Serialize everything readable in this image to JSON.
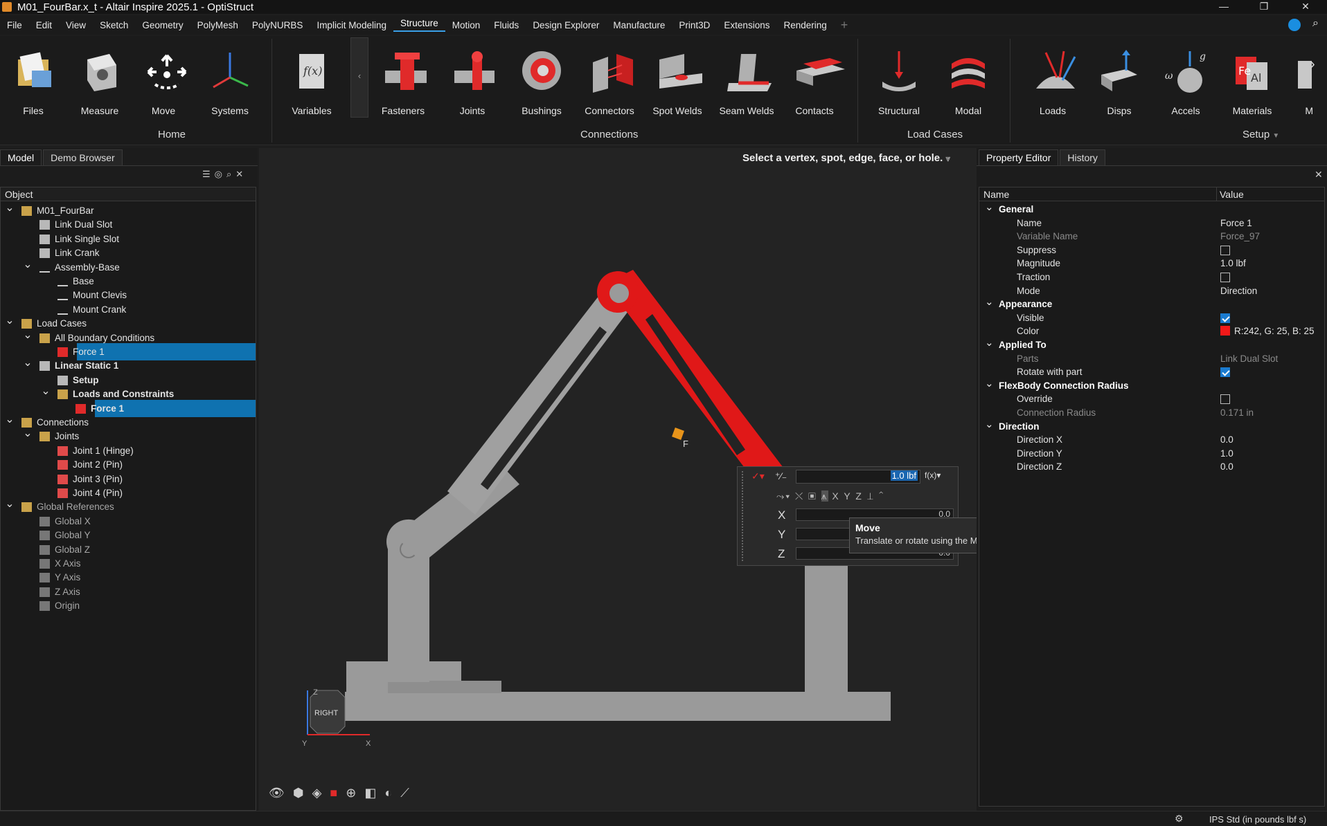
{
  "window": {
    "title": "M01_FourBar.x_t - Altair Inspire 2025.1 - OptiStruct"
  },
  "menu": [
    "File",
    "Edit",
    "View",
    "Sketch",
    "Geometry",
    "PolyMesh",
    "PolyNURBS",
    "Implicit Modeling",
    "Structure",
    "Motion",
    "Fluids",
    "Design Explorer",
    "Manufacture",
    "Print3D",
    "Extensions",
    "Rendering"
  ],
  "ribbon": {
    "home": {
      "group": "Home",
      "tools": [
        "Files",
        "Measure",
        "Move",
        "Systems"
      ]
    },
    "variables": "Variables",
    "connections": {
      "group": "Connections",
      "tools": [
        "Fasteners",
        "Joints",
        "Bushings",
        "Connectors",
        "Spot Welds",
        "Seam Welds",
        "Contacts"
      ]
    },
    "loadcases": {
      "group": "Load Cases",
      "tools": [
        "Structural",
        "Modal"
      ]
    },
    "setup": {
      "group": "Setup",
      "tools": [
        "Loads",
        "Disps",
        "Accels",
        "Materials",
        "M"
      ]
    }
  },
  "left": {
    "tabs": [
      "Model",
      "Demo Browser"
    ],
    "column": "Object",
    "rows": [
      {
        "label": "M01_FourBar",
        "level": 0,
        "chev": "v"
      },
      {
        "label": "Link Dual Slot",
        "level": 1
      },
      {
        "label": "Link Single Slot",
        "level": 1
      },
      {
        "label": "Link Crank",
        "level": 1
      },
      {
        "label": "Assembly-Base",
        "level": 1,
        "chev": "v"
      },
      {
        "label": "Base",
        "level": 2
      },
      {
        "label": "Mount Clevis",
        "level": 2
      },
      {
        "label": "Mount Crank",
        "level": 2
      },
      {
        "label": "Load Cases",
        "level": 0,
        "chev": "v"
      },
      {
        "label": "All Boundary Conditions",
        "level": 1,
        "chev": "v"
      },
      {
        "label": "Force 1",
        "level": 2,
        "sel": true
      },
      {
        "label": "Linear Static 1",
        "level": 1,
        "chev": "v",
        "bold": true
      },
      {
        "label": "Setup",
        "level": 2,
        "bold": true
      },
      {
        "label": "Loads and Constraints",
        "level": 2,
        "chev": "v",
        "bold": true
      },
      {
        "label": "Force 1",
        "level": 3,
        "sel": true,
        "bold": true
      },
      {
        "label": "Connections",
        "level": 0,
        "chev": "v"
      },
      {
        "label": "Joints",
        "level": 1,
        "chev": "v"
      },
      {
        "label": "Joint 1 (Hinge)",
        "level": 2
      },
      {
        "label": "Joint 2 (Pin)",
        "level": 2
      },
      {
        "label": "Joint 3 (Pin)",
        "level": 2
      },
      {
        "label": "Joint 4 (Pin)",
        "level": 2
      },
      {
        "label": "Global References",
        "level": 0,
        "chev": "v",
        "dim": true
      },
      {
        "label": "Global X",
        "level": 1,
        "dim": true
      },
      {
        "label": "Global Y",
        "level": 1,
        "dim": true
      },
      {
        "label": "Global Z",
        "level": 1,
        "dim": true
      },
      {
        "label": "X Axis",
        "level": 1,
        "dim": true
      },
      {
        "label": "Y Axis",
        "level": 1,
        "dim": true
      },
      {
        "label": "Z Axis",
        "level": 1,
        "dim": true
      },
      {
        "label": "Origin",
        "level": 1,
        "dim": true
      }
    ]
  },
  "viewport": {
    "prompt": "Select a vertex, spot, edge, face, or hole.",
    "force_label": "F",
    "microdialog": {
      "magnitude": "1.0 lbf",
      "fx": "f(x)",
      "x": "X",
      "y": "Y",
      "z": "Z",
      "xval": "0.0",
      "zval": "0.0",
      "axes": [
        "X",
        "Y",
        "Z"
      ]
    },
    "tooltip": {
      "title": "Move",
      "text": "Translate or rotate using the Move tool."
    },
    "viewcube": "RIGHT",
    "triad": {
      "z": "Z",
      "y": "Y",
      "x": "X"
    }
  },
  "right": {
    "tabs": [
      "Property Editor",
      "History"
    ],
    "col_name": "Name",
    "col_value": "Value",
    "rows": [
      {
        "t": "cat",
        "name": "General"
      },
      {
        "name": "Name",
        "value": "Force 1"
      },
      {
        "name": "Variable Name",
        "value": "Force_97",
        "dim": true
      },
      {
        "name": "Suppress",
        "cb": false
      },
      {
        "name": "Magnitude",
        "value": "1.0 lbf"
      },
      {
        "name": "Traction",
        "cb": false
      },
      {
        "name": "Mode",
        "value": "Direction"
      },
      {
        "t": "cat",
        "name": "Appearance"
      },
      {
        "name": "Visible",
        "cb": true
      },
      {
        "name": "Color",
        "value": "R:242, G: 25, B: 25",
        "swatch": "#f21919"
      },
      {
        "t": "cat",
        "name": "Applied To"
      },
      {
        "name": "Parts",
        "value": "Link Dual Slot",
        "dim": true
      },
      {
        "name": "Rotate with part",
        "cb": true
      },
      {
        "t": "cat",
        "name": "FlexBody Connection Radius"
      },
      {
        "name": "Override",
        "cb": false
      },
      {
        "name": "Connection Radius",
        "value": "0.171 in",
        "dim": true
      },
      {
        "t": "cat",
        "name": "Direction"
      },
      {
        "name": "Direction X",
        "value": "0.0"
      },
      {
        "name": "Direction Y",
        "value": "1.0"
      },
      {
        "name": "Direction Z",
        "value": "0.0"
      }
    ]
  },
  "status": {
    "units": "IPS Std (in pounds lbf s)"
  },
  "colors": {
    "accent": "#0f72b0",
    "force": "#e01818",
    "part": "#9a9a9a"
  }
}
